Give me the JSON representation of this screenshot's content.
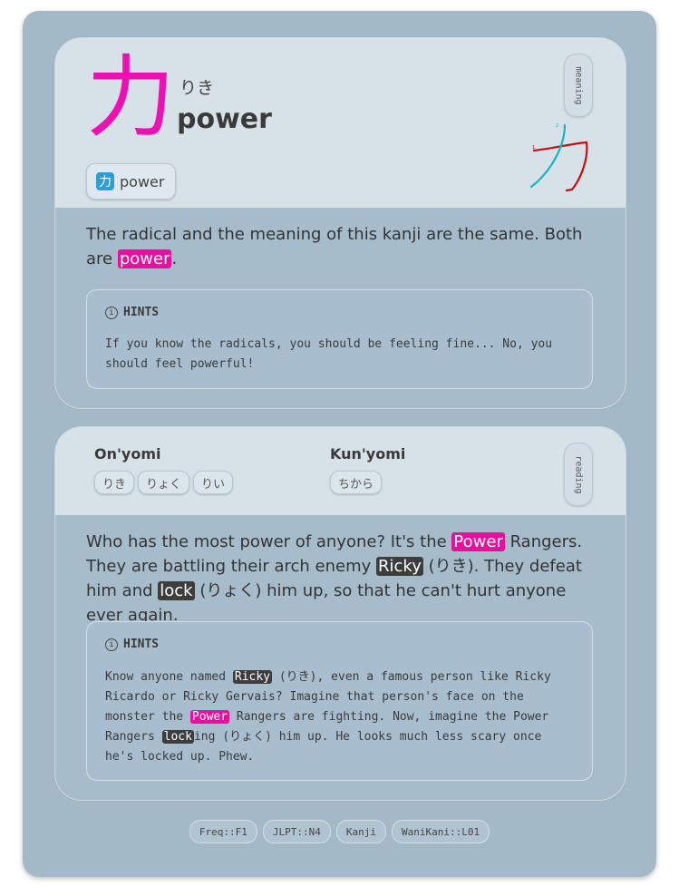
{
  "kanji": {
    "character": "力",
    "reading": "りき",
    "meaning": "power",
    "radical_glyph": "力",
    "radical_name": "power",
    "meaning_tab": "meaning"
  },
  "meaning_section": {
    "text_before": "The radical and the meaning of this kanji are the same. Both are ",
    "highlight": "power",
    "text_after": ".",
    "hints_title": "HINTS",
    "hints_text": "If you know the radicals, you should be feeling fine... No, you should feel powerful!"
  },
  "readings": {
    "onyomi_label": "On'yomi",
    "onyomi": [
      "りき",
      "りょく",
      "りい"
    ],
    "kunyomi_label": "Kun'yomi",
    "kunyomi": [
      "ちから"
    ],
    "reading_tab": "reading"
  },
  "reading_section": {
    "t1": "Who has the most power of anyone? It's the ",
    "h1": "Power",
    "t2": " Rangers. They are battling their arch enemy ",
    "h2": "Ricky",
    "t3": " (りき). They defeat him and ",
    "h3": "lock",
    "t4": " (りょく) him up, so that he can't hurt anyone ever again.",
    "hints_title": "HINTS",
    "hint_t1": "Know anyone named ",
    "hint_h1": "Ricky",
    "hint_t2": " (りき), even a famous person like Ricky Ricardo or Ricky Gervais? Imagine that person's face on the monster the ",
    "hint_h2": "Power",
    "hint_t3": " Rangers are fighting. Now, imagine the Power Rangers ",
    "hint_h3": "lock",
    "hint_t4": "ing (りょく) him up. He looks much less scary once he's locked up. Phew."
  },
  "tags": [
    "Freq::F1",
    "JLPT::N4",
    "Kanji",
    "WaniKani::L01"
  ],
  "colors": {
    "accent": "#ef10b4",
    "highlight_pink": "#e80f9f",
    "highlight_dark": "#3d3d3d",
    "background": "#a3b9c8",
    "header": "#d6e1e8"
  },
  "stroke_numbers": [
    "1",
    "2"
  ]
}
